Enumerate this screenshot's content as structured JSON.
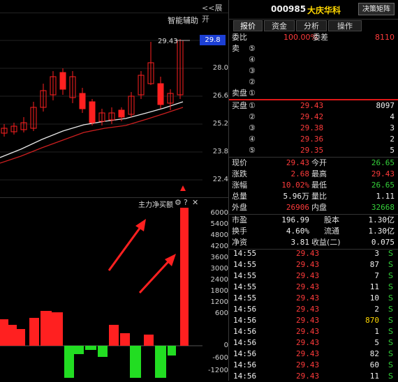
{
  "header": {
    "code": "000985",
    "name": "大庆华科",
    "expand_label": "展开",
    "expand_arrows": "<<",
    "decision_button": "决策矩阵"
  },
  "tabs": [
    "报价",
    "资金",
    "分析",
    "操作"
  ],
  "chart": {
    "assist_label": "智能辅助",
    "price_marker": "29.43",
    "price_ticks": [
      "29.8",
      "28.0",
      "26.6",
      "25.2",
      "23.8",
      "22.4"
    ],
    "indicator_title": "主力净买额",
    "indicator_ticks": [
      "6000",
      "5400",
      "4800",
      "4200",
      "3600",
      "3000",
      "2400",
      "1800",
      "1200",
      "600",
      "0",
      "-600",
      "-1200"
    ],
    "colors": {
      "up": "#ff2020",
      "down": "#22dd22",
      "ma1": "#e8e8e8",
      "ma2": "#cc1f1f"
    }
  },
  "weibi": {
    "label": "委比",
    "value": "100.00%",
    "label2": "委差",
    "value2": "8110"
  },
  "sells": [
    {
      "label": "卖",
      "num": "⑤",
      "price": "",
      "vol": ""
    },
    {
      "label": "",
      "num": "④",
      "price": "",
      "vol": ""
    },
    {
      "label": "",
      "num": "③",
      "price": "",
      "vol": ""
    },
    {
      "label": "",
      "num": "②",
      "price": "",
      "vol": ""
    },
    {
      "label": "卖盘",
      "num": "①",
      "price": "",
      "vol": ""
    }
  ],
  "buys": [
    {
      "label": "买盘",
      "num": "①",
      "price": "29.43",
      "vol": "8097"
    },
    {
      "label": "",
      "num": "②",
      "price": "29.42",
      "vol": "4"
    },
    {
      "label": "",
      "num": "③",
      "price": "29.38",
      "vol": "3"
    },
    {
      "label": "",
      "num": "④",
      "price": "29.36",
      "vol": "2"
    },
    {
      "label": "",
      "num": "⑤",
      "price": "29.35",
      "vol": "5"
    }
  ],
  "quote": [
    {
      "l1": "现价",
      "v1": "29.43",
      "c1": "red",
      "l2": "今开",
      "v2": "26.65",
      "c2": "green"
    },
    {
      "l1": "涨跌",
      "v1": "2.68",
      "c1": "red",
      "l2": "最高",
      "v2": "29.43",
      "c2": "red"
    },
    {
      "l1": "涨幅",
      "v1": "10.02%",
      "c1": "red",
      "l2": "最低",
      "v2": "26.65",
      "c2": "green"
    },
    {
      "l1": "总量",
      "v1": "5.96万",
      "c1": "white",
      "l2": "量比",
      "v2": "1.11",
      "c2": "white"
    },
    {
      "l1": "外盘",
      "v1": "26906",
      "c1": "red",
      "l2": "内盘",
      "v2": "32668",
      "c2": "green"
    }
  ],
  "stats": [
    {
      "l1": "市盈",
      "v1": "196.99",
      "l2": "股本",
      "v2": "1.30亿"
    },
    {
      "l1": "换手",
      "v1": "4.60%",
      "l2": "流通",
      "v2": "1.30亿"
    },
    {
      "l1": "净资",
      "v1": "3.81",
      "l2": "收益(二)",
      "v2": "0.075"
    }
  ],
  "ticks": [
    {
      "time": "14:55",
      "price": "29.43",
      "vol": "3",
      "side": "S"
    },
    {
      "time": "14:55",
      "price": "29.43",
      "vol": "87",
      "side": "S"
    },
    {
      "time": "14:55",
      "price": "29.43",
      "vol": "7",
      "side": "S"
    },
    {
      "time": "14:55",
      "price": "29.43",
      "vol": "11",
      "side": "S"
    },
    {
      "time": "14:55",
      "price": "29.43",
      "vol": "10",
      "side": "S"
    },
    {
      "time": "14:56",
      "price": "29.43",
      "vol": "2",
      "side": "S"
    },
    {
      "time": "14:56",
      "price": "29.43",
      "vol": "870",
      "side": "S"
    },
    {
      "time": "14:56",
      "price": "29.43",
      "vol": "1",
      "side": "S"
    },
    {
      "time": "14:56",
      "price": "29.43",
      "vol": "5",
      "side": "S"
    },
    {
      "time": "14:56",
      "price": "29.43",
      "vol": "82",
      "side": "S"
    },
    {
      "time": "14:56",
      "price": "29.43",
      "vol": "60",
      "side": "S"
    },
    {
      "time": "14:56",
      "price": "29.43",
      "vol": "11",
      "side": "S"
    }
  ]
}
